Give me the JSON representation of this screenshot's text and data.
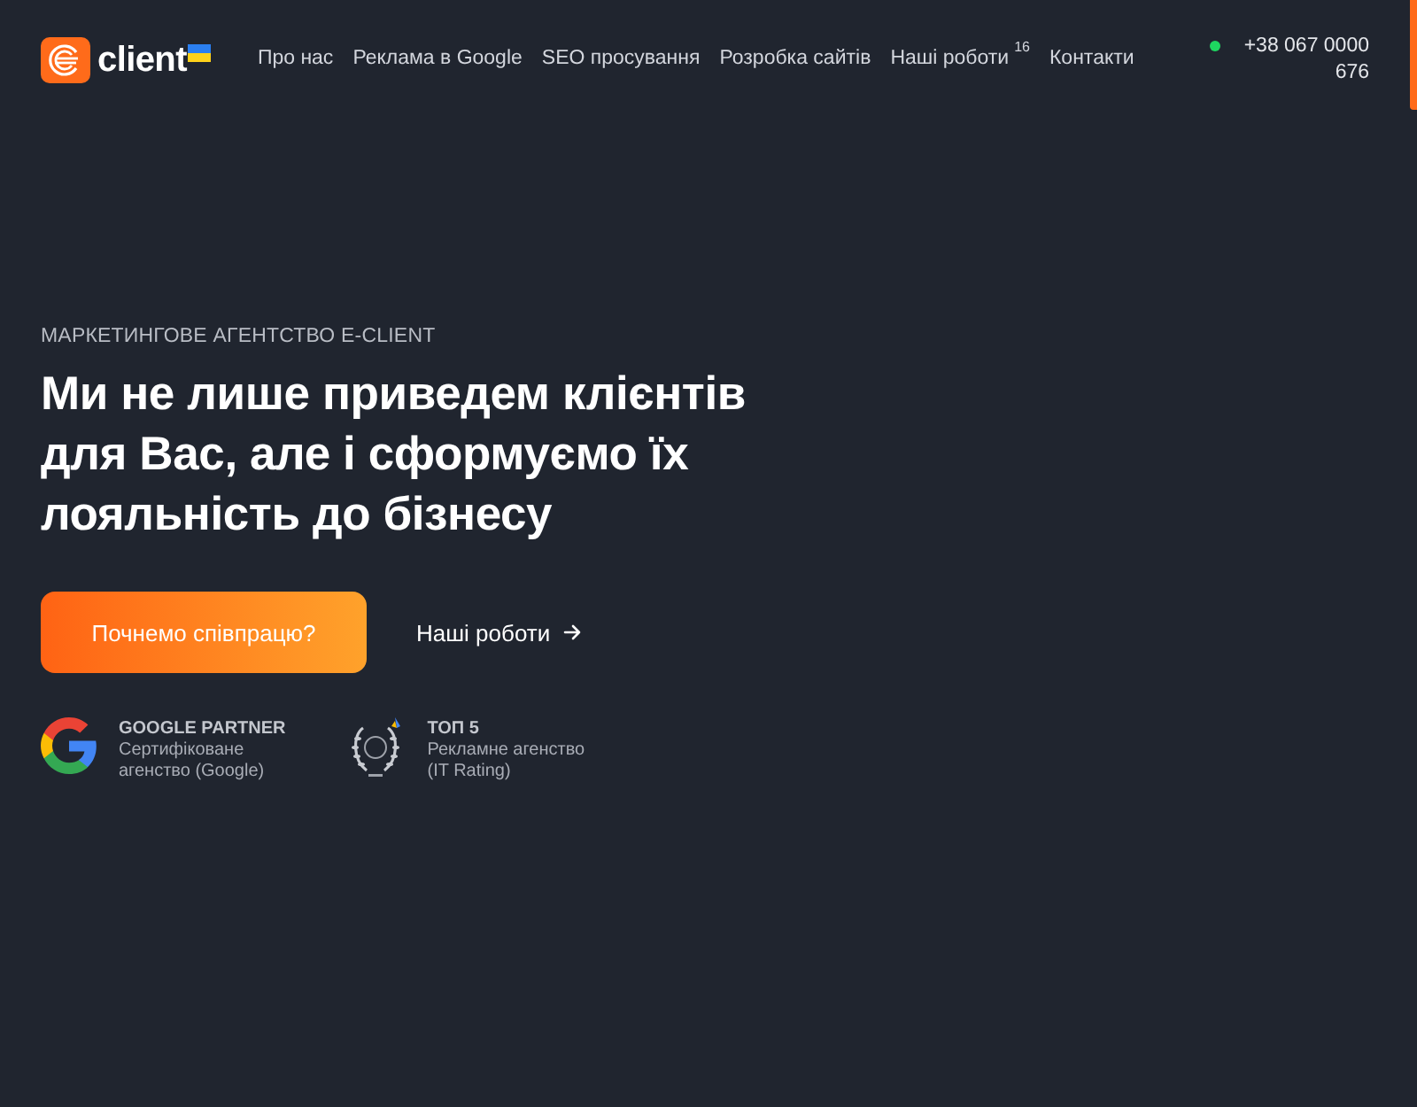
{
  "header": {
    "logo": {
      "text": "client"
    },
    "nav": [
      {
        "label": "Про нас"
      },
      {
        "label": "Реклама в Google"
      },
      {
        "label": "SEO просування"
      },
      {
        "label": "Розробка сайтів"
      },
      {
        "label": "Наші роботи",
        "count": "16"
      },
      {
        "label": "Контакти"
      }
    ],
    "phone": {
      "number": "+38 067 0000 676",
      "online": true
    }
  },
  "hero": {
    "eyebrow": "МАРКЕТИНГОВЕ АГЕНТСТВО E-CLIENT",
    "title": "Ми не лише приведем клієнтів для Вас, але і сформуємо їх лояльність до бізнесу",
    "primary_button": "Почнемо співпрацю?",
    "secondary_link": "Наші роботи"
  },
  "badges": [
    {
      "kind": "google",
      "title": "GOOGLE PARTNER",
      "text": "Сертифіковане агенство (Google)"
    },
    {
      "kind": "award",
      "title": "ТОП 5",
      "text": "Рекламне агенство (IT Rating)"
    }
  ]
}
